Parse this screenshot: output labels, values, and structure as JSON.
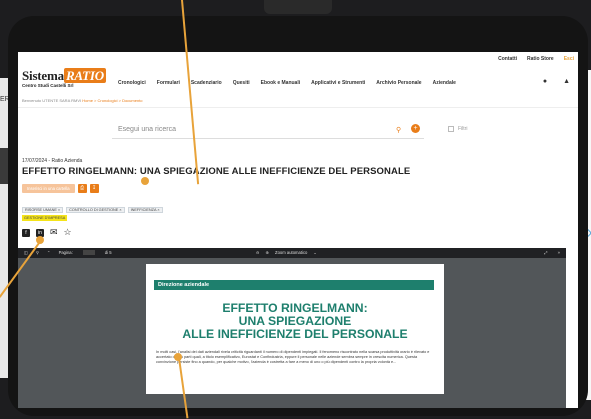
{
  "background": {
    "left_text": "ER"
  },
  "topbar": {
    "links": [
      "Contatti",
      "Ratio Store",
      "Esci"
    ]
  },
  "brand": {
    "name_a": "Sistema",
    "name_b": "RATIO",
    "sub": "Centro Studi Castelli Srl"
  },
  "nav": {
    "items": [
      "Cronologici",
      "Formulari",
      "Scadenziario",
      "Quesiti",
      "Ebook e Manuali",
      "Applicativi e Strumenti",
      "Archivio Personale",
      "Aziendale"
    ]
  },
  "breadcrumb": {
    "welcome": "Benvenuto UTENTE SARA RMVI",
    "path": "Home > Cronologici > Documento"
  },
  "search": {
    "placeholder": "Esegui una ricerca",
    "filters_label": "Filtri"
  },
  "article": {
    "meta": "17/07/2024 - Ratio Azienda",
    "title": "EFFETTO RINGELMANN: UNA SPIEGAZIONE ALLE INEFFICIENZE DEL PERSONALE",
    "cart_label": "Inserisci in una cartella",
    "tags": [
      "RISORSE UMANE ×",
      "CONTROLLO DI GESTIONE ×",
      "INEFFICIENZA ×"
    ],
    "tag_highlight": "GESTIONE D'IMPRESA"
  },
  "pdf": {
    "page_label": "Pagina:",
    "page_total": "di 5",
    "zoom": "Zoom automatico",
    "section": "Direzione aziendale",
    "heading_line1": "EFFETTO RINGELMANN:",
    "heading_line2": "UNA SPIEGAZIONE",
    "heading_line3": "ALLE INEFFICIENZE DEL PERSONALE",
    "body": "In molti casi, l'analisi dei dati aziendali rivela criticità riguardanti il numero di dipendenti impiegati. Il fenomeno riscontrato nella scarsa produttività orario è rilevato e accertato da più parti quali, a titolo esemplificativo, Eurostat e Confindustria, eppure il personale nelle aziende sembra sempre in crescita numerica. Questa convinzione persiste fino a quando, per qualche motivo, l'azienda è costretta a fare a meno di uno o più dipendenti contro la propria volontà e..."
  },
  "colors": {
    "accent": "#e97d19",
    "brand_green": "#1e7f6d",
    "tag_highlight": "#f5e41a",
    "annotation": "#e8a33a"
  }
}
